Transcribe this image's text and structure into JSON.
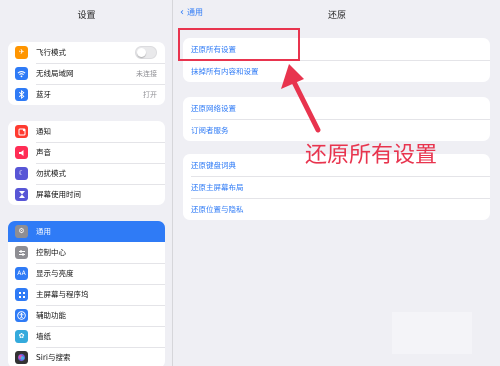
{
  "sidebar": {
    "title": "设置",
    "group1": [
      {
        "icon": "airplane-icon",
        "label": "飞行模式",
        "color": "#ff9500",
        "toggle": true
      },
      {
        "icon": "wifi-icon",
        "label": "无线局域网",
        "value": "未连接",
        "color": "#2f7bf6"
      },
      {
        "icon": "bluetooth-icon",
        "label": "蓝牙",
        "value": "打开",
        "color": "#2f7bf6"
      }
    ],
    "group2": [
      {
        "icon": "notification-icon",
        "label": "通知",
        "color": "#ff3b30"
      },
      {
        "icon": "sound-icon",
        "label": "声音",
        "color": "#ff2d55"
      },
      {
        "icon": "do-not-disturb-icon",
        "label": "勿扰模式",
        "color": "#5856d6"
      },
      {
        "icon": "screen-time-icon",
        "label": "屏幕使用时间",
        "color": "#5856d6"
      }
    ],
    "group3": [
      {
        "icon": "gear-icon",
        "label": "通用",
        "color": "#8e8e93",
        "selected": true
      },
      {
        "icon": "control-center-icon",
        "label": "控制中心",
        "color": "#8e8e93"
      },
      {
        "icon": "display-icon",
        "label": "显示与亮度",
        "color": "#2f7bf6"
      },
      {
        "icon": "home-screen-icon",
        "label": "主屏幕与程序坞",
        "color": "#2f7bf6"
      },
      {
        "icon": "accessibility-icon",
        "label": "辅助功能",
        "color": "#2f7bf6"
      },
      {
        "icon": "wallpaper-icon",
        "label": "墙纸",
        "color": "#34aadc"
      },
      {
        "icon": "siri-icon",
        "label": "Siri与搜索",
        "color": "#333333"
      }
    ]
  },
  "main": {
    "back_label": "通用",
    "title": "还原",
    "group1": [
      "还原所有设置",
      "抹掉所有内容和设置"
    ],
    "group2": [
      "还原网络设置",
      "订阅者服务"
    ],
    "group3": [
      "还原键盘词典",
      "还原主屏幕布局",
      "还原位置与隐私"
    ]
  },
  "annotation": {
    "text": "还原所有设置",
    "color": "#e8344e"
  }
}
